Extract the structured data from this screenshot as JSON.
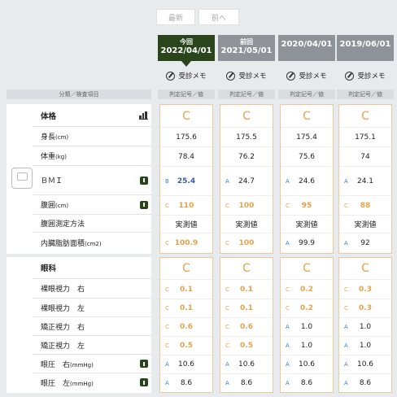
{
  "nav": {
    "latest_label": "最新",
    "prev_label": "前へ"
  },
  "dates": [
    {
      "label": "今回",
      "date": "2022/04/01",
      "memo": "受診メモ"
    },
    {
      "label": "前回",
      "date": "2021/05/01",
      "memo": "受診メモ"
    },
    {
      "label": "",
      "date": "2020/04/01",
      "memo": "受診メモ"
    },
    {
      "label": "",
      "date": "2019/06/01",
      "memo": "受診メモ"
    }
  ],
  "headers": {
    "category": "分類／検査項目",
    "judgement": "判定記号／値"
  },
  "groups": [
    {
      "name": "体格",
      "icon": "bar-chart-icon",
      "overall": [
        "C",
        "C",
        "C",
        "C"
      ],
      "rows": [
        {
          "label": "身長",
          "unit": "(cm)",
          "info": false,
          "cells": [
            {
              "g": "",
              "v": "175.6",
              "s": "black"
            },
            {
              "g": "",
              "v": "175.5",
              "s": "black"
            },
            {
              "g": "",
              "v": "175.4",
              "s": "black"
            },
            {
              "g": "",
              "v": "175.1",
              "s": "black"
            }
          ]
        },
        {
          "label": "体重",
          "unit": "(kg)",
          "info": false,
          "cells": [
            {
              "g": "",
              "v": "78.4",
              "s": "black"
            },
            {
              "g": "",
              "v": "76.2",
              "s": "black"
            },
            {
              "g": "",
              "v": "75.6",
              "s": "black"
            },
            {
              "g": "",
              "v": "74",
              "s": "black"
            }
          ]
        },
        {
          "label": "ＢＭＩ",
          "unit": "",
          "info": true,
          "cells": [
            {
              "g": "B",
              "v": "25.4",
              "s": "blue"
            },
            {
              "g": "A",
              "v": "24.7",
              "s": "black"
            },
            {
              "g": "A",
              "v": "24.6",
              "s": "black"
            },
            {
              "g": "A",
              "v": "24.1",
              "s": "black"
            }
          ]
        },
        {
          "label": "腹囲",
          "unit": "(cm)",
          "info": true,
          "cells": [
            {
              "g": "C",
              "v": "110",
              "s": "orange"
            },
            {
              "g": "C",
              "v": "100",
              "s": "orange"
            },
            {
              "g": "C",
              "v": "95",
              "s": "orange"
            },
            {
              "g": "C",
              "v": "88",
              "s": "orange"
            }
          ]
        },
        {
          "label": "腹囲測定方法",
          "unit": "",
          "info": false,
          "cells": [
            {
              "g": "",
              "v": "実測値",
              "s": "black"
            },
            {
              "g": "",
              "v": "実測値",
              "s": "black"
            },
            {
              "g": "",
              "v": "実測値",
              "s": "black"
            },
            {
              "g": "",
              "v": "実測値",
              "s": "black"
            }
          ]
        },
        {
          "label": "内臓脂肪面積",
          "unit": "(cm2)",
          "info": false,
          "cells": [
            {
              "g": "C",
              "v": "100.9",
              "s": "orange"
            },
            {
              "g": "C",
              "v": "100",
              "s": "orange"
            },
            {
              "g": "A",
              "v": "99.9",
              "s": "black"
            },
            {
              "g": "A",
              "v": "92",
              "s": "black"
            }
          ]
        }
      ]
    },
    {
      "name": "眼科",
      "icon": "",
      "overall": [
        "C",
        "C",
        "C",
        "C"
      ],
      "rows": [
        {
          "label": "裸眼視力　右",
          "unit": "",
          "info": false,
          "cells": [
            {
              "g": "C",
              "v": "0.1",
              "s": "orange"
            },
            {
              "g": "C",
              "v": "0.1",
              "s": "orange"
            },
            {
              "g": "C",
              "v": "0.2",
              "s": "orange"
            },
            {
              "g": "C",
              "v": "0.3",
              "s": "orange"
            }
          ]
        },
        {
          "label": "裸眼視力　左",
          "unit": "",
          "info": false,
          "cells": [
            {
              "g": "C",
              "v": "0.1",
              "s": "orange"
            },
            {
              "g": "C",
              "v": "0.1",
              "s": "orange"
            },
            {
              "g": "C",
              "v": "0.2",
              "s": "orange"
            },
            {
              "g": "C",
              "v": "0.3",
              "s": "orange"
            }
          ]
        },
        {
          "label": "矯正視力　右",
          "unit": "",
          "info": false,
          "cells": [
            {
              "g": "C",
              "v": "0.6",
              "s": "orange"
            },
            {
              "g": "C",
              "v": "0.6",
              "s": "orange"
            },
            {
              "g": "A",
              "v": "1.0",
              "s": "black"
            },
            {
              "g": "A",
              "v": "1.0",
              "s": "black"
            }
          ]
        },
        {
          "label": "矯正視力　左",
          "unit": "",
          "info": false,
          "cells": [
            {
              "g": "C",
              "v": "0.5",
              "s": "orange"
            },
            {
              "g": "C",
              "v": "0.5",
              "s": "orange"
            },
            {
              "g": "A",
              "v": "1.0",
              "s": "black"
            },
            {
              "g": "A",
              "v": "1.0",
              "s": "black"
            }
          ]
        },
        {
          "label": "眼圧　右",
          "unit": "(mmHg)",
          "info": true,
          "cells": [
            {
              "g": "A",
              "v": "10.6",
              "s": "black"
            },
            {
              "g": "A",
              "v": "10.6",
              "s": "black"
            },
            {
              "g": "A",
              "v": "10.6",
              "s": "black"
            },
            {
              "g": "A",
              "v": "10.6",
              "s": "black"
            }
          ]
        },
        {
          "label": "眼圧　左",
          "unit": "(mmHg)",
          "info": true,
          "cells": [
            {
              "g": "A",
              "v": "8.6",
              "s": "black"
            },
            {
              "g": "A",
              "v": "8.6",
              "s": "black"
            },
            {
              "g": "A",
              "v": "8.6",
              "s": "black"
            },
            {
              "g": "A",
              "v": "8.6",
              "s": "black"
            }
          ]
        }
      ]
    }
  ]
}
